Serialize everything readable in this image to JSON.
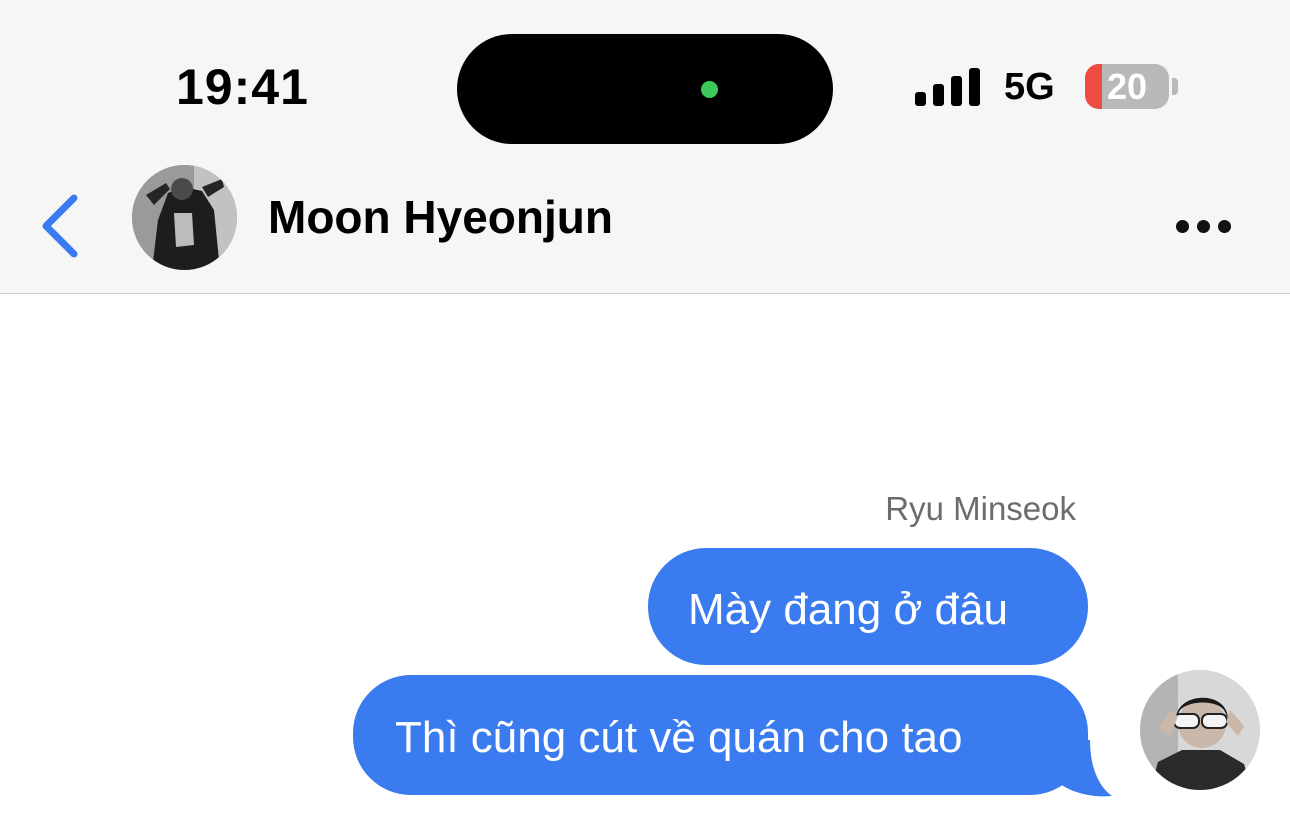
{
  "status_bar": {
    "time": "19:41",
    "network": "5G",
    "battery_percent": "20",
    "battery_level": 0.2,
    "colors": {
      "island_dot": "#3ccb5b",
      "battery_low": "#ee4b43"
    }
  },
  "header": {
    "back_icon": "chevron-left-icon",
    "contact_name": "Moon Hyeonjun",
    "more_icon": "ellipsis-icon",
    "accent_color": "#3a7bf0"
  },
  "chat": {
    "sender_name": "Ryu Minseok",
    "bubble_color": "#3a7bf0",
    "messages": [
      {
        "text": "Mày đang ở đâu"
      },
      {
        "text": "Thì cũng cút về quán cho tao"
      }
    ]
  }
}
